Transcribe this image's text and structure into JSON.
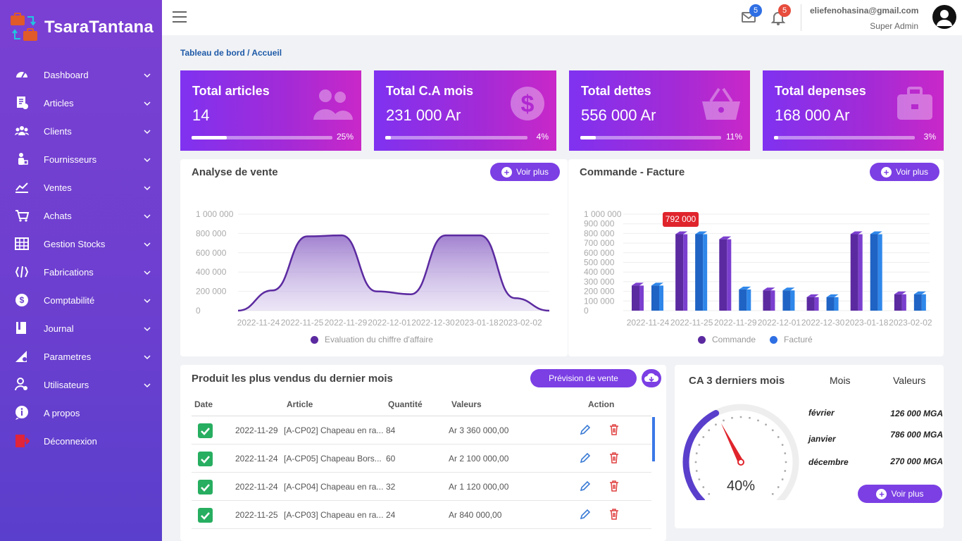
{
  "brand": {
    "name": "TsaraTantana"
  },
  "sidebar": {
    "items": [
      {
        "label": "Dashboard",
        "icon": "gauge-icon",
        "has_submenu": true
      },
      {
        "label": "Articles",
        "icon": "document-icon",
        "has_submenu": true
      },
      {
        "label": "Clients",
        "icon": "users-icon",
        "has_submenu": true
      },
      {
        "label": "Fournisseurs",
        "icon": "supplier-icon",
        "has_submenu": true
      },
      {
        "label": "Ventes",
        "icon": "chart-line-icon",
        "has_submenu": true
      },
      {
        "label": "Achats",
        "icon": "cart-icon",
        "has_submenu": true
      },
      {
        "label": "Gestion Stocks",
        "icon": "warehouse-icon",
        "has_submenu": true
      },
      {
        "label": "Fabrications",
        "icon": "tools-icon",
        "has_submenu": true
      },
      {
        "label": "Comptabilité",
        "icon": "coin-icon",
        "has_submenu": true
      },
      {
        "label": "Journal",
        "icon": "book-icon",
        "has_submenu": true
      },
      {
        "label": "Parametres",
        "icon": "settings-icon",
        "has_submenu": true
      },
      {
        "label": "Utilisateurs",
        "icon": "user-settings-icon",
        "has_submenu": true
      },
      {
        "label": "A propos",
        "icon": "info-icon",
        "has_submenu": false
      },
      {
        "label": "Déconnexion",
        "icon": "logout-icon",
        "has_submenu": false
      }
    ]
  },
  "topbar": {
    "mail_count": "5",
    "notif_count": "5",
    "user_email": "eliefenohasina@gmail.com",
    "user_role": "Super Admin"
  },
  "breadcrumb": "Tableau de bord / Accueil",
  "stats": [
    {
      "title": "Total articles",
      "value": "14",
      "pct_label": "25%",
      "pct": 0.25,
      "icon": "users-icon"
    },
    {
      "title": "Total C.A mois",
      "value": "231 000 Ar",
      "pct_label": "4%",
      "pct": 0.04,
      "icon": "dollar-icon"
    },
    {
      "title": "Total dettes",
      "value": "556 000 Ar",
      "pct_label": "11%",
      "pct": 0.11,
      "icon": "basket-icon"
    },
    {
      "title": "Total depenses",
      "value": "168 000 Ar",
      "pct_label": "3%",
      "pct": 0.03,
      "icon": "briefcase-icon"
    }
  ],
  "sales_card": {
    "title": "Analyse de vente",
    "button": "Voir plus"
  },
  "orders_card": {
    "title": "Commande - Facture",
    "button": "Voir plus",
    "tooltip": "792 000"
  },
  "chart_data": [
    {
      "type": "area",
      "categories": [
        "2022-11-24",
        "2022-11-25",
        "2022-11-29",
        "2022-12-01",
        "2022-12-30",
        "2023-01-18",
        "2023-02-02"
      ],
      "series": [
        {
          "name": "Evaluation du chiffre d'affaire",
          "values": [
            0,
            210000,
            770000,
            780000,
            200000,
            170000,
            780000,
            780000,
            130000,
            0
          ]
        }
      ],
      "y_ticks": [
        "1 000 000",
        "800 000",
        "600 000",
        "400 000",
        "200 000",
        "0"
      ],
      "ylim": [
        0,
        1000000
      ],
      "legend": "bottom",
      "color": "#5b2aa0"
    },
    {
      "type": "bar",
      "categories": [
        "2022-11-24",
        "2022-11-25",
        "2022-11-29",
        "2022-12-01",
        "2022-12-30",
        "2023-01-18",
        "2023-02-02"
      ],
      "series": [
        {
          "name": "Commande",
          "values": [
            260000,
            792000,
            740000,
            210000,
            140000,
            792000,
            170000
          ],
          "color": "#7b3fcf"
        },
        {
          "name": "Facturé",
          "values": [
            260000,
            792000,
            220000,
            210000,
            140000,
            792000,
            170000
          ],
          "color": "#2f87ea"
        }
      ],
      "y_ticks": [
        "1 000 000",
        "900 000",
        "800 000",
        "700 000",
        "600 000",
        "500 000",
        "400 000",
        "300 000",
        "200 000",
        "100 000",
        "0"
      ],
      "ylim": [
        0,
        1000000
      ],
      "legend": "bottom"
    }
  ],
  "products": {
    "title": "Produit les plus vendus du dernier mois",
    "forecast_button": "Prévision de vente",
    "columns": {
      "date": "Date",
      "article": "Article",
      "quantity": "Quantité",
      "value": "Valeurs",
      "action": "Action"
    },
    "rows": [
      {
        "date": "2022-11-29",
        "article": "[A-CP02] Chapeau en ra...",
        "quantity": "84",
        "value": "Ar 3 360 000,00"
      },
      {
        "date": "2022-11-24",
        "article": "[A-CP05] Chapeau Bors...",
        "quantity": "60",
        "value": "Ar 2 100 000,00"
      },
      {
        "date": "2022-11-24",
        "article": "[A-CP04] Chapeau en ra...",
        "quantity": "32",
        "value": "Ar 1 120 000,00"
      },
      {
        "date": "2022-11-25",
        "article": "[A-CP03] Chapeau en ra...",
        "quantity": "24",
        "value": "Ar 840 000,00"
      }
    ]
  },
  "ca3": {
    "title": "CA 3 derniers mois",
    "col_month": "Mois",
    "col_value": "Valeurs",
    "gauge_label": "40%",
    "gauge_value": 0.4,
    "rows": [
      {
        "month": "février",
        "value": "126 000 MGA"
      },
      {
        "month": "janvier",
        "value": "786 000 MGA"
      },
      {
        "month": "décembre",
        "value": "270 000 MGA"
      }
    ],
    "button": "Voir plus"
  }
}
